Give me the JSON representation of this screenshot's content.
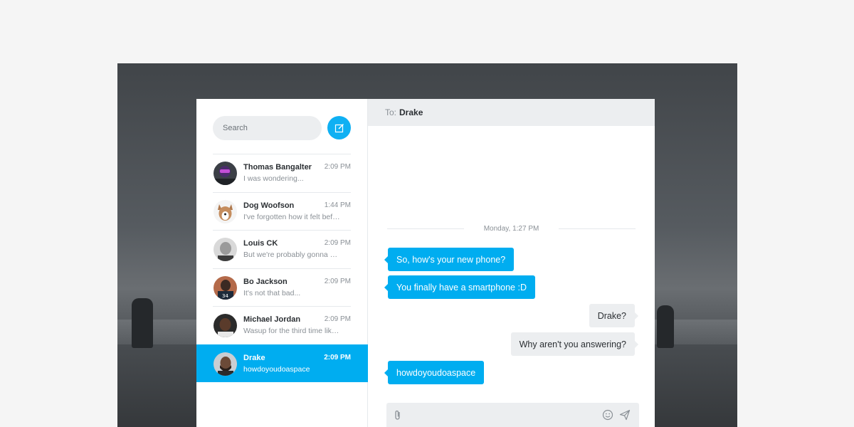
{
  "sidebar": {
    "search_placeholder": "Search",
    "compose_icon": "compose-icon",
    "contacts": [
      {
        "name": "Thomas Bangalter",
        "time": "2:09 PM",
        "preview": "I was wondering...",
        "active": false
      },
      {
        "name": "Dog Woofson",
        "time": "1:44 PM",
        "preview": "I've forgotten how it felt before",
        "active": false
      },
      {
        "name": "Louis CK",
        "time": "2:09 PM",
        "preview": "But we're probably gonna need a new carpet",
        "active": false
      },
      {
        "name": "Bo Jackson",
        "time": "2:09 PM",
        "preview": "It's not that bad...",
        "active": false
      },
      {
        "name": "Michael Jordan",
        "time": "2:09 PM",
        "preview": "Wasup for the third time like is you blind",
        "active": false
      },
      {
        "name": "Drake",
        "time": "2:09 PM",
        "preview": "howdoyoudoaspace",
        "active": true
      }
    ]
  },
  "chat": {
    "to_label": "To:",
    "to_name": "Drake",
    "date_divider": "Monday, 1:27 PM",
    "messages": [
      {
        "direction": "in",
        "text": "So, how's your new phone?"
      },
      {
        "direction": "in",
        "text": "You finally have a smartphone :D"
      },
      {
        "direction": "out",
        "text": "Drake?"
      },
      {
        "direction": "out",
        "text": "Why aren't you answering?"
      },
      {
        "direction": "in",
        "text": "howdoyoudoaspace"
      }
    ],
    "composer": {
      "value": "",
      "attach_icon": "paperclip-icon",
      "emoji_icon": "smiley-icon",
      "send_icon": "send-icon"
    }
  },
  "colors": {
    "accent": "#00adf0",
    "bubble_out": "#eceef0",
    "page_bg": "#f5f5f5"
  }
}
